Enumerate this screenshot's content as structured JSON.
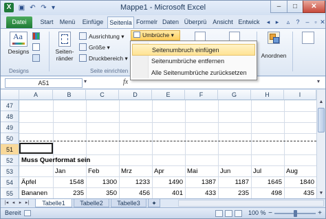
{
  "window": {
    "title": "Mappe1 - Microsoft Excel"
  },
  "qat": {
    "save_icon": "save-icon",
    "undo_icon": "undo-icon",
    "redo_icon": "redo-icon"
  },
  "tabs": [
    {
      "label": "Datei"
    },
    {
      "label": "Start"
    },
    {
      "label": "Menü"
    },
    {
      "label": "Einfüge"
    },
    {
      "label": "Seitenla"
    },
    {
      "label": "Formelr"
    },
    {
      "label": "Daten"
    },
    {
      "label": "Überprü"
    },
    {
      "label": "Ansicht"
    },
    {
      "label": "Entwick"
    }
  ],
  "ribbon": {
    "designs_label": "Designs",
    "designs_btn": "Designs",
    "seitenraender_line1": "Seiten-",
    "seitenraender_line2": "ränder",
    "ausrichtung": "Ausrichtung",
    "groesse": "Größe",
    "druckbereich": "Druckbereich",
    "umbrueche": "Umbrüche",
    "seite_einrichten": "Seite einrichten",
    "anordnen": "Anordnen"
  },
  "dropdown": {
    "items": [
      {
        "label": "Seitenumbruch einfügen"
      },
      {
        "label": "Seitenumbrüche entfernen"
      },
      {
        "label": "Alle Seitenumbrüche zurücksetzen"
      }
    ]
  },
  "formula_bar": {
    "name_box": "A51",
    "fx": "fx"
  },
  "columns": [
    "A",
    "B",
    "C",
    "D",
    "E",
    "F",
    "G",
    "H",
    "I"
  ],
  "rows": [
    "47",
    "48",
    "49",
    "50",
    "51",
    "52",
    "53",
    "54",
    "55"
  ],
  "cells": {
    "r52_a": "Muss Querformat sein",
    "r53": [
      "Jan",
      "Feb",
      "Mrz",
      "Apr",
      "Mai",
      "Jun",
      "Jul",
      "Aug"
    ],
    "r54_a": "Äpfel",
    "r54": [
      "1548",
      "1300",
      "1233",
      "1490",
      "1387",
      "1187",
      "1645",
      "1840"
    ],
    "r55_a": "Bananen",
    "r55": [
      "235",
      "350",
      "456",
      "401",
      "433",
      "235",
      "498",
      "435"
    ]
  },
  "sheets": [
    {
      "label": "Tabelle1"
    },
    {
      "label": "Tabelle2"
    },
    {
      "label": "Tabelle3"
    }
  ],
  "status": {
    "text": "Bereit",
    "zoom": "100 %"
  }
}
